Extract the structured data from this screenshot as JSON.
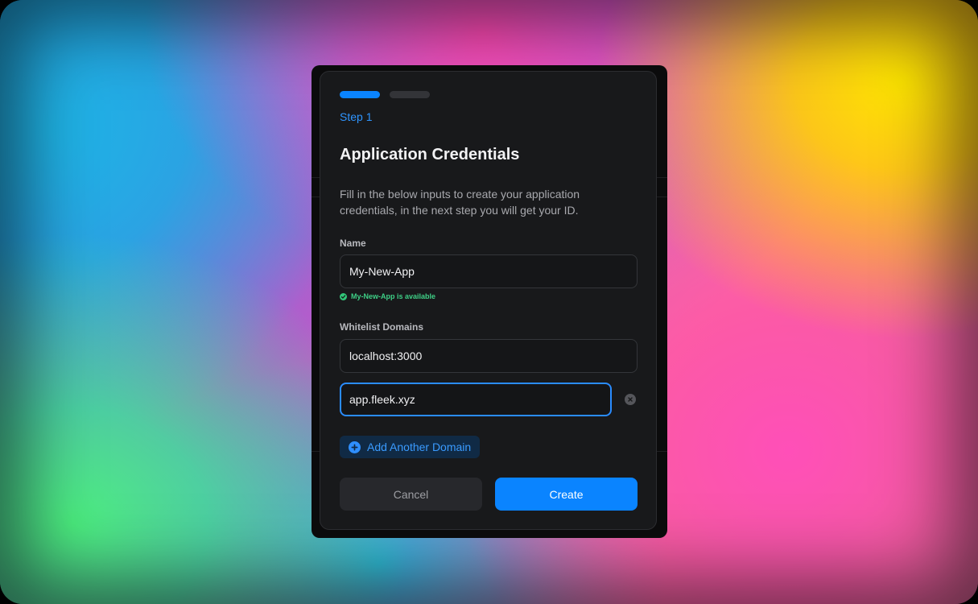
{
  "stepper": {
    "current": 1,
    "total": 2
  },
  "step_label": "Step 1",
  "title": "Application Credentials",
  "description": "Fill in the below inputs to create your application credentials, in the next step you will get your ID.",
  "name_field": {
    "label": "Name",
    "value": "My-New-App",
    "availability": "My-New-App is available"
  },
  "domains_field": {
    "label": "Whitelist Domains",
    "domains": [
      "localhost:3000",
      "app.fleek.xyz"
    ]
  },
  "add_domain_label": "Add Another Domain",
  "actions": {
    "cancel": "Cancel",
    "create": "Create"
  },
  "colors": {
    "accent": "#0a84ff",
    "success": "#3ecf86",
    "surface": "#18191b"
  },
  "icons": [
    "check-circle-icon",
    "close-circle-icon",
    "plus-circle-icon"
  ]
}
